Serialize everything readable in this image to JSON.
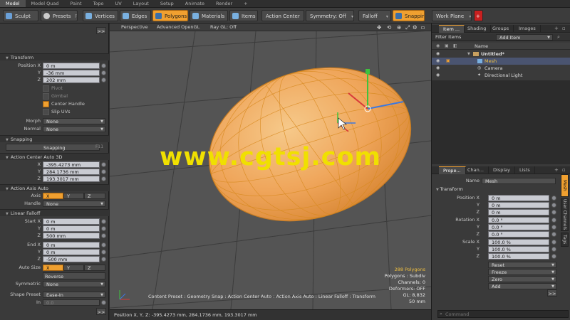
{
  "menubar": {
    "items": [
      {
        "label": "Model",
        "active": true
      },
      {
        "label": "Model Quad",
        "active": false
      },
      {
        "label": "Paint",
        "active": false
      },
      {
        "label": "Topo",
        "active": false
      },
      {
        "label": "UV",
        "active": false
      },
      {
        "label": "Layout",
        "active": false
      },
      {
        "label": "Setup",
        "active": false
      },
      {
        "label": "Animate",
        "active": false
      },
      {
        "label": "Render",
        "active": false
      },
      {
        "label": "+",
        "active": false
      }
    ]
  },
  "toolbar": {
    "sculpt": "Sculpt",
    "presets": "Presets",
    "presets_key": "F6",
    "vertices": "Vertices",
    "edges": "Edges",
    "polygons": "Polygons",
    "materials": "Materials",
    "items": "Items",
    "action_center": "Action Center",
    "symmetry": "Symmetry: Off",
    "falloff": "Falloff",
    "snapping": "Snapping",
    "work_plane": "Work Plane",
    "add": "+"
  },
  "left": {
    "expand": ">>",
    "transform": {
      "title": "Transform",
      "position_label": "Position X",
      "y_label": "Y",
      "z_label": "Z",
      "x": "0 m",
      "y": "-36 mm",
      "z": "202 mm",
      "pivot": "Pivot",
      "gimbal": "Gimbal",
      "center_handle": "Center Handle",
      "slip_uvs": "Slip UVs",
      "morph_label": "Morph",
      "morph": "None",
      "normal_label": "Normal",
      "normal": "None"
    },
    "snapping": {
      "title": "Snapping",
      "button": "Snapping",
      "key": "F11"
    },
    "action_center": {
      "title": "Action Center Auto 3D",
      "x_label": "X",
      "y_label": "Y",
      "z_label": "Z",
      "x": "-395.4273 mm",
      "y": "284.1736 mm",
      "z": "193.3017 mm"
    },
    "action_axis": {
      "title": "Action Axis Auto",
      "axis_label": "Axis",
      "x": "X",
      "y": "Y",
      "z": "Z",
      "handle_label": "Handle",
      "handle": "None"
    },
    "linear_falloff": {
      "title": "Linear Falloff",
      "start_label": "Start X",
      "start_x": "0 m",
      "start_y": "0 m",
      "start_z": "500 mm",
      "end_label": "End X",
      "end_x": "0 m",
      "end_y": "0 m",
      "end_z": "-500 mm",
      "y_label": "Y",
      "z_label": "Z",
      "auto_size_label": "Auto Size",
      "x": "X",
      "y": "Y",
      "z": "Z",
      "reverse": "Reverse",
      "symmetric_label": "Symmetric",
      "symmetric": "None",
      "shape_label": "Shape Preset",
      "shape": "Ease-In",
      "in_label": "In",
      "in_value": "0.0"
    },
    "bottom_expand": ">>"
  },
  "viewport": {
    "view": "Perspective",
    "shading": "Advanced OpenGL",
    "ray_gl": "Ray GL: Off",
    "watermark": "www.cgtsj.com",
    "info": {
      "polygons": "288 Polygons",
      "preset": "Polygons : Subdiv",
      "channels": "Channels: 0",
      "deformers": "Deformers: OFF",
      "gl": "GL: 8,832",
      "size": "50 mm"
    },
    "status_line": "Content Preset : Geometry Snap : Action Center Auto : Action Axis Auto : Linear Falloff : Transform",
    "mesh_color": "#f5a94a",
    "wire_color": "#d88a20"
  },
  "statusbar": {
    "text": "Position X, Y, Z:  -395.4273 mm, 284.1736 mm, 193.3017 mm"
  },
  "right": {
    "top_tabs": [
      "Item ...",
      "Shading",
      "Groups",
      "Images"
    ],
    "filter_label": "Filter Items",
    "add_item": "Add Item",
    "column_name": "Name",
    "items": [
      {
        "name": "Untitled*",
        "bold": true
      },
      {
        "name": "Mesh",
        "selected": true
      },
      {
        "name": "Camera"
      },
      {
        "name": "Directional Light"
      }
    ],
    "bottom_tabs": [
      "Prope...",
      "Chan...",
      "Display",
      "Lists"
    ],
    "name_label": "Name",
    "name_value": "Mesh",
    "transform_title": "Transform",
    "position_label": "Position X",
    "rotation_label": "Rotation X",
    "scale_label": "Scale X",
    "y_label": "Y",
    "z_label": "Z",
    "pos": [
      "0 m",
      "0 m",
      "0 m"
    ],
    "rot": [
      "0.0 °",
      "0.0 °",
      "0.0 °"
    ],
    "scl": [
      "100.0 %",
      "100.0 %",
      "100.0 %"
    ],
    "buttons": [
      "Reset",
      "Freeze",
      "Zero",
      "Add"
    ],
    "side_tabs": [
      "Mesh",
      "User Channels",
      "Tags"
    ],
    "expand": ">>",
    "command_placeholder": "Command"
  }
}
